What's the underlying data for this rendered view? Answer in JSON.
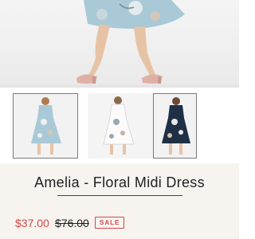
{
  "product": {
    "title": "Amelia - Floral Midi Dress",
    "sale_price": "$37.00",
    "original_price": "$76.00",
    "badge": "SALE"
  },
  "gallery": {
    "hero": {
      "icon": "product-photo"
    },
    "thumbnails": [
      {
        "dress_color": "#a9c9d6",
        "selected": true
      },
      {
        "dress_color": "#f2f2f2",
        "selected": false
      },
      {
        "dress_color": "#1f2f45",
        "selected": false
      }
    ]
  },
  "colors": {
    "sale_red": "#d04a4a",
    "panel_bg": "#f7f3ef"
  }
}
